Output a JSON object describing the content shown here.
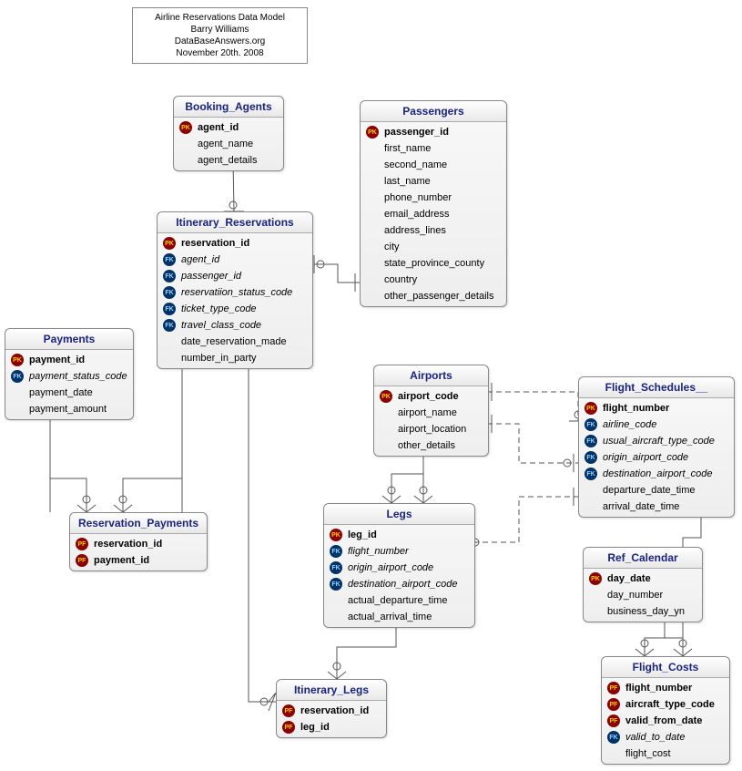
{
  "title": {
    "line1": "Airline Reservations Data Model",
    "line2": "Barry Williams",
    "line3": "DataBaseAnswers.org",
    "line4": "November 20th. 2008"
  },
  "entities": {
    "booking_agents": {
      "name": "Booking_Agents",
      "cols": [
        {
          "key": "PK",
          "name": "agent_id",
          "b": true
        },
        {
          "key": "",
          "name": "agent_name"
        },
        {
          "key": "",
          "name": "agent_details"
        }
      ]
    },
    "passengers": {
      "name": "Passengers",
      "cols": [
        {
          "key": "PK",
          "name": "passenger_id",
          "b": true
        },
        {
          "key": "",
          "name": "first_name"
        },
        {
          "key": "",
          "name": "second_name"
        },
        {
          "key": "",
          "name": "last_name"
        },
        {
          "key": "",
          "name": "phone_number"
        },
        {
          "key": "",
          "name": "email_address"
        },
        {
          "key": "",
          "name": "address_lines"
        },
        {
          "key": "",
          "name": "city"
        },
        {
          "key": "",
          "name": "state_province_county"
        },
        {
          "key": "",
          "name": "country"
        },
        {
          "key": "",
          "name": "other_passenger_details"
        }
      ]
    },
    "itinerary_reservations": {
      "name": "Itinerary_Reservations",
      "cols": [
        {
          "key": "PK",
          "name": "reservation_id",
          "b": true
        },
        {
          "key": "FK",
          "name": "agent_id",
          "i": true
        },
        {
          "key": "FK",
          "name": "passenger_id",
          "i": true
        },
        {
          "key": "FK",
          "name": "reservatiion_status_code",
          "i": true
        },
        {
          "key": "FK",
          "name": "ticket_type_code",
          "i": true
        },
        {
          "key": "FK",
          "name": "travel_class_code",
          "i": true
        },
        {
          "key": "",
          "name": "date_reservation_made"
        },
        {
          "key": "",
          "name": "number_in_party"
        }
      ]
    },
    "payments": {
      "name": "Payments",
      "cols": [
        {
          "key": "PK",
          "name": "payment_id",
          "b": true
        },
        {
          "key": "FK",
          "name": "payment_status_code",
          "i": true
        },
        {
          "key": "",
          "name": "payment_date"
        },
        {
          "key": "",
          "name": "payment_amount"
        }
      ]
    },
    "reservation_payments": {
      "name": "Reservation_Payments",
      "cols": [
        {
          "key": "PF",
          "name": "reservation_id",
          "b": true
        },
        {
          "key": "PF",
          "name": "payment_id",
          "b": true
        }
      ]
    },
    "airports": {
      "name": "Airports",
      "cols": [
        {
          "key": "PK",
          "name": "airport_code",
          "b": true
        },
        {
          "key": "",
          "name": "airport_name"
        },
        {
          "key": "",
          "name": "airport_location"
        },
        {
          "key": "",
          "name": "other_details"
        }
      ]
    },
    "legs": {
      "name": "Legs",
      "cols": [
        {
          "key": "PK",
          "name": "leg_id",
          "b": true
        },
        {
          "key": "FK",
          "name": "flight_number",
          "i": true
        },
        {
          "key": "FK",
          "name": "origin_airport_code",
          "i": true
        },
        {
          "key": "FK",
          "name": "destination_airport_code",
          "i": true
        },
        {
          "key": "",
          "name": "actual_departure_time"
        },
        {
          "key": "",
          "name": "actual_arrival_time"
        }
      ]
    },
    "flight_schedules": {
      "name": "Flight_Schedules__",
      "cols": [
        {
          "key": "PK",
          "name": "flight_number",
          "b": true
        },
        {
          "key": "FK",
          "name": "airline_code",
          "i": true
        },
        {
          "key": "FK",
          "name": "usual_aircraft_type_code",
          "i": true
        },
        {
          "key": "FK",
          "name": "origin_airport_code",
          "i": true
        },
        {
          "key": "FK",
          "name": "destination_airport_code",
          "i": true
        },
        {
          "key": "",
          "name": "departure_date_time"
        },
        {
          "key": "",
          "name": "arrival_date_time"
        }
      ]
    },
    "itinerary_legs": {
      "name": "Itinerary_Legs",
      "cols": [
        {
          "key": "PF",
          "name": "reservation_id",
          "b": true
        },
        {
          "key": "PF",
          "name": "leg_id",
          "b": true
        }
      ]
    },
    "ref_calendar": {
      "name": "Ref_Calendar",
      "cols": [
        {
          "key": "PK",
          "name": "day_date",
          "b": true
        },
        {
          "key": "",
          "name": "day_number"
        },
        {
          "key": "",
          "name": "business_day_yn"
        }
      ]
    },
    "flight_costs": {
      "name": "Flight_Costs",
      "cols": [
        {
          "key": "PF",
          "name": "flight_number",
          "b": true
        },
        {
          "key": "PF",
          "name": "aircraft_type_code",
          "b": true
        },
        {
          "key": "PF",
          "name": "valid_from_date",
          "b": true
        },
        {
          "key": "FK",
          "name": "valid_to_date",
          "i": true
        },
        {
          "key": "",
          "name": "flight_cost"
        }
      ]
    }
  }
}
